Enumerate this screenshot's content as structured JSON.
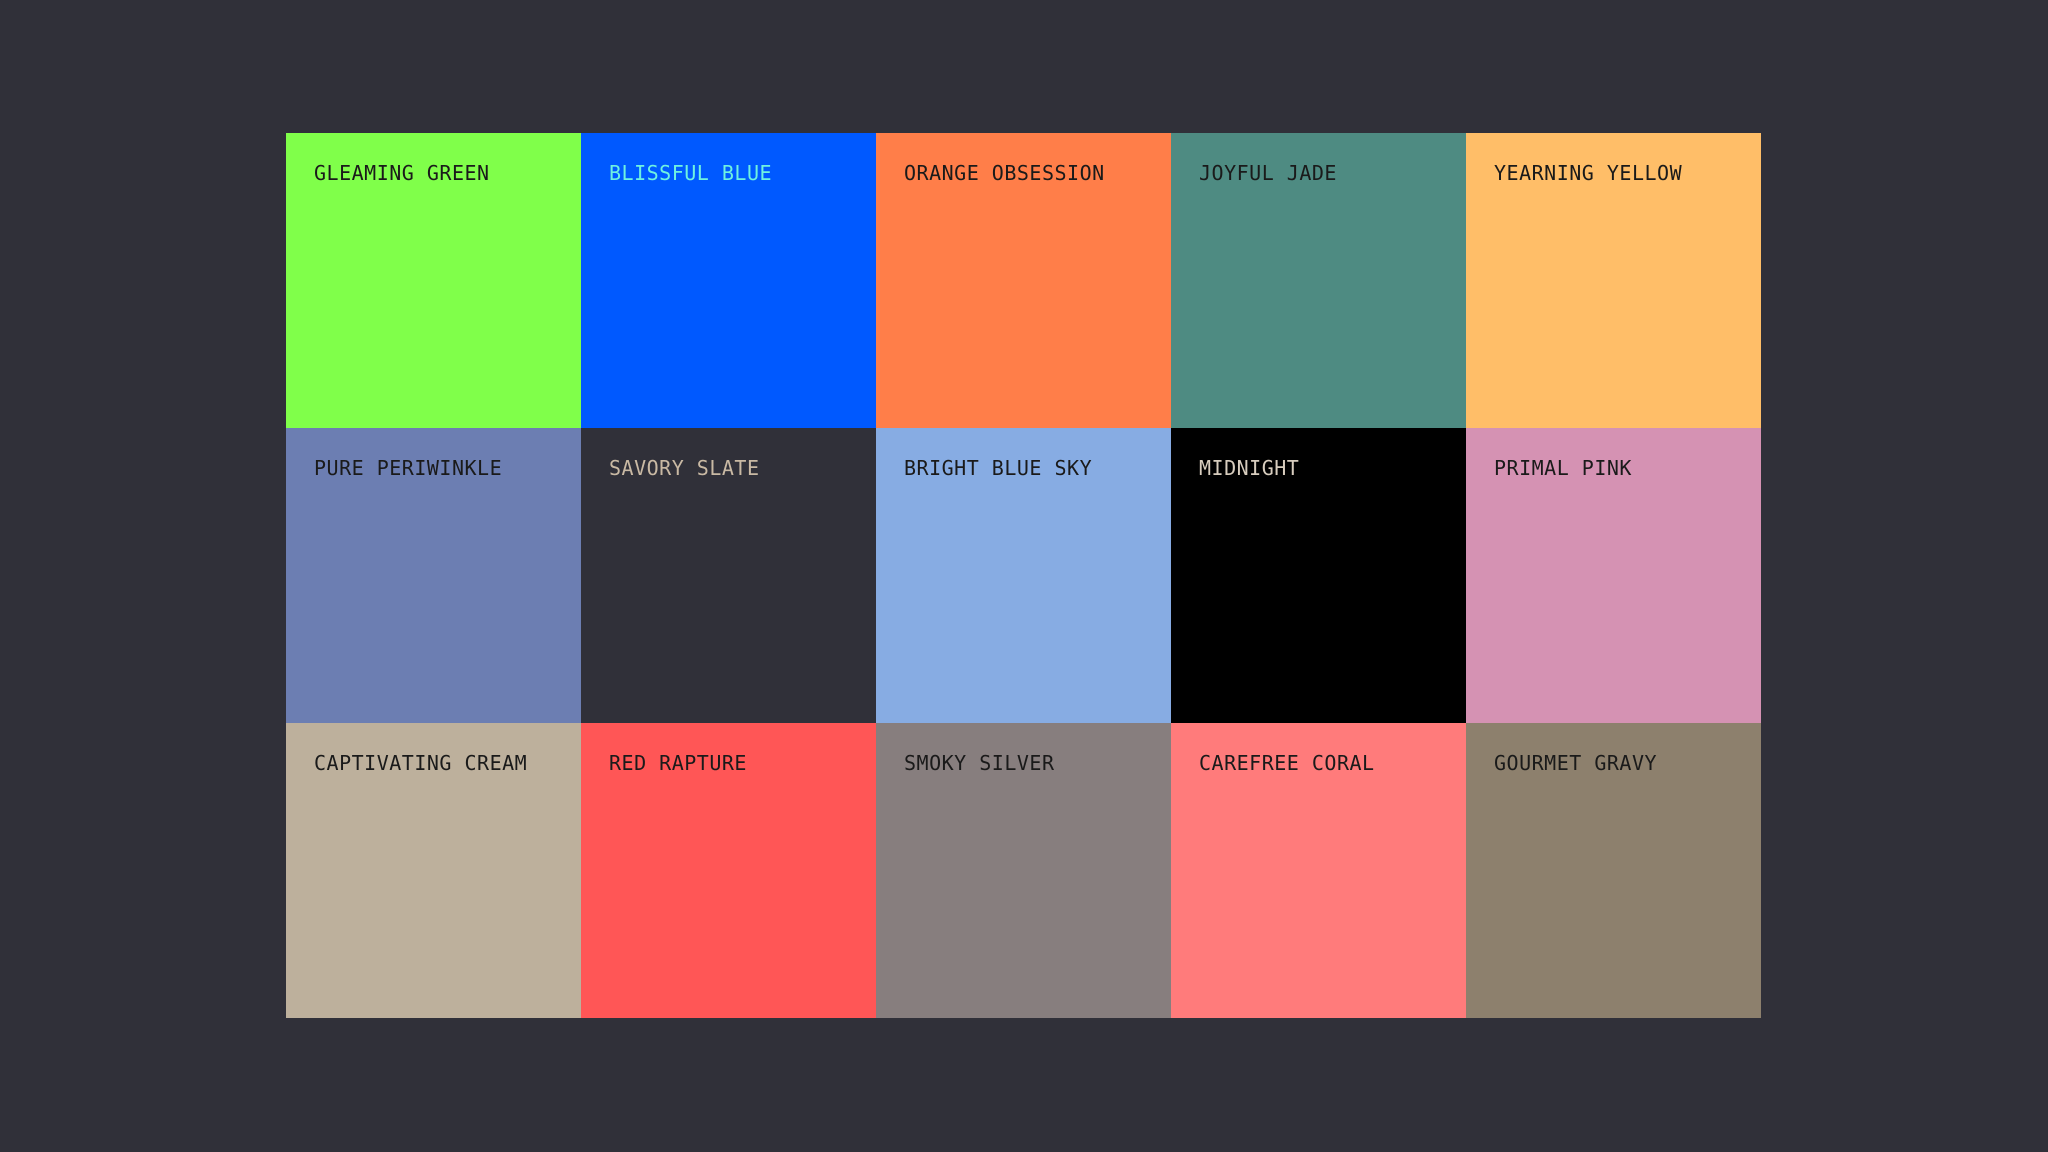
{
  "palette": {
    "background": "#303039",
    "swatches": [
      {
        "name": "GLEAMING GREEN",
        "color": "#80FF4A",
        "text_color": "#1A1A1A"
      },
      {
        "name": "BLISSFUL BLUE",
        "color": "#0059FF",
        "text_color": "#6FF2E0"
      },
      {
        "name": "ORANGE OBSESSION",
        "color": "#FF7E49",
        "text_color": "#1A1A1A"
      },
      {
        "name": "JOYFUL JADE",
        "color": "#4E8B82",
        "text_color": "#1A1A1A"
      },
      {
        "name": "YEARNING YELLOW",
        "color": "#FFBE68",
        "text_color": "#1A1A1A"
      },
      {
        "name": "PURE PERIWINKLE",
        "color": "#6C7EB2",
        "text_color": "#1A1A1A"
      },
      {
        "name": "SAVORY SLATE",
        "color": "#303039",
        "text_color": "#C9B9A4"
      },
      {
        "name": "BRIGHT BLUE SKY",
        "color": "#87ACE3",
        "text_color": "#1A1A1A"
      },
      {
        "name": "MIDNIGHT",
        "color": "#000000",
        "text_color": "#D8CDBE"
      },
      {
        "name": "PRIMAL PINK",
        "color": "#D592B3",
        "text_color": "#1A1A1A"
      },
      {
        "name": "CAPTIVATING CREAM",
        "color": "#BDB09C",
        "text_color": "#1A1A1A"
      },
      {
        "name": "RED RAPTURE",
        "color": "#FF5656",
        "text_color": "#1A1A1A"
      },
      {
        "name": "SMOKY SILVER",
        "color": "#877E7E",
        "text_color": "#1A1A1A"
      },
      {
        "name": "CAREFREE CORAL",
        "color": "#FF7B7B",
        "text_color": "#1A1A1A"
      },
      {
        "name": "GOURMET GRAVY",
        "color": "#8D806D",
        "text_color": "#1A1A1A"
      }
    ]
  }
}
